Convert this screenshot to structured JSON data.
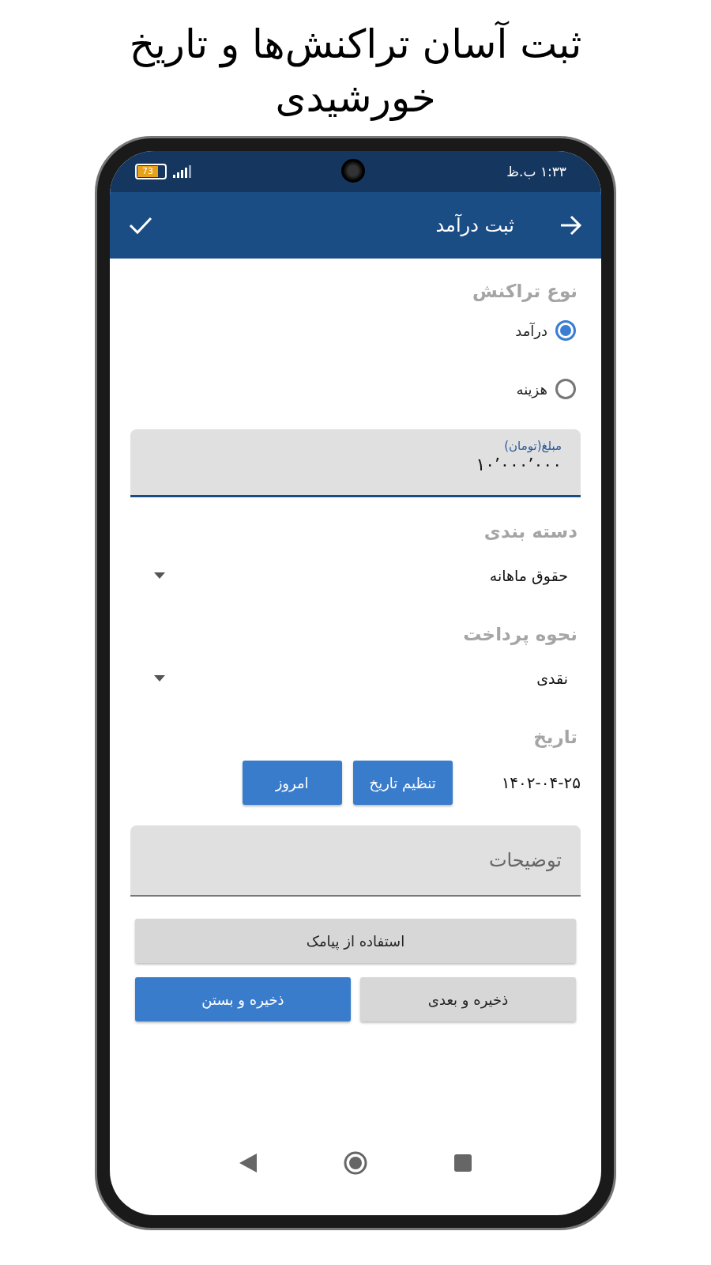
{
  "headline": "ثبت آسان تراکنش‌ها و تاریخ خورشیدی",
  "status_bar": {
    "time": "۱:۳۳ ب.ظ",
    "battery": "73"
  },
  "app_bar": {
    "title": "ثبت درآمد"
  },
  "transaction_type": {
    "label": "نوع تراکنش",
    "options": [
      {
        "label": "درآمد",
        "selected": true
      },
      {
        "label": "هزینه",
        "selected": false
      }
    ]
  },
  "amount": {
    "label": "مبلغ(تومان)",
    "value": "۱۰٬۰۰۰٬۰۰۰"
  },
  "category": {
    "label": "دسته بندی",
    "value": "حقوق ماهانه"
  },
  "payment_method": {
    "label": "نحوه پرداخت",
    "value": "نقدی"
  },
  "date": {
    "label": "تاریخ",
    "value": "۱۴۰۲-۰۴-۲۵",
    "buttons": [
      "تنظیم تاریخ",
      "امروز"
    ]
  },
  "description": {
    "placeholder": "توضیحات"
  },
  "sms_button": "استفاده از پیامک",
  "buttons": [
    {
      "label": "ذخیره و بعدی",
      "kind": "secondary"
    },
    {
      "label": "ذخیره و بستن",
      "kind": "primary"
    }
  ]
}
